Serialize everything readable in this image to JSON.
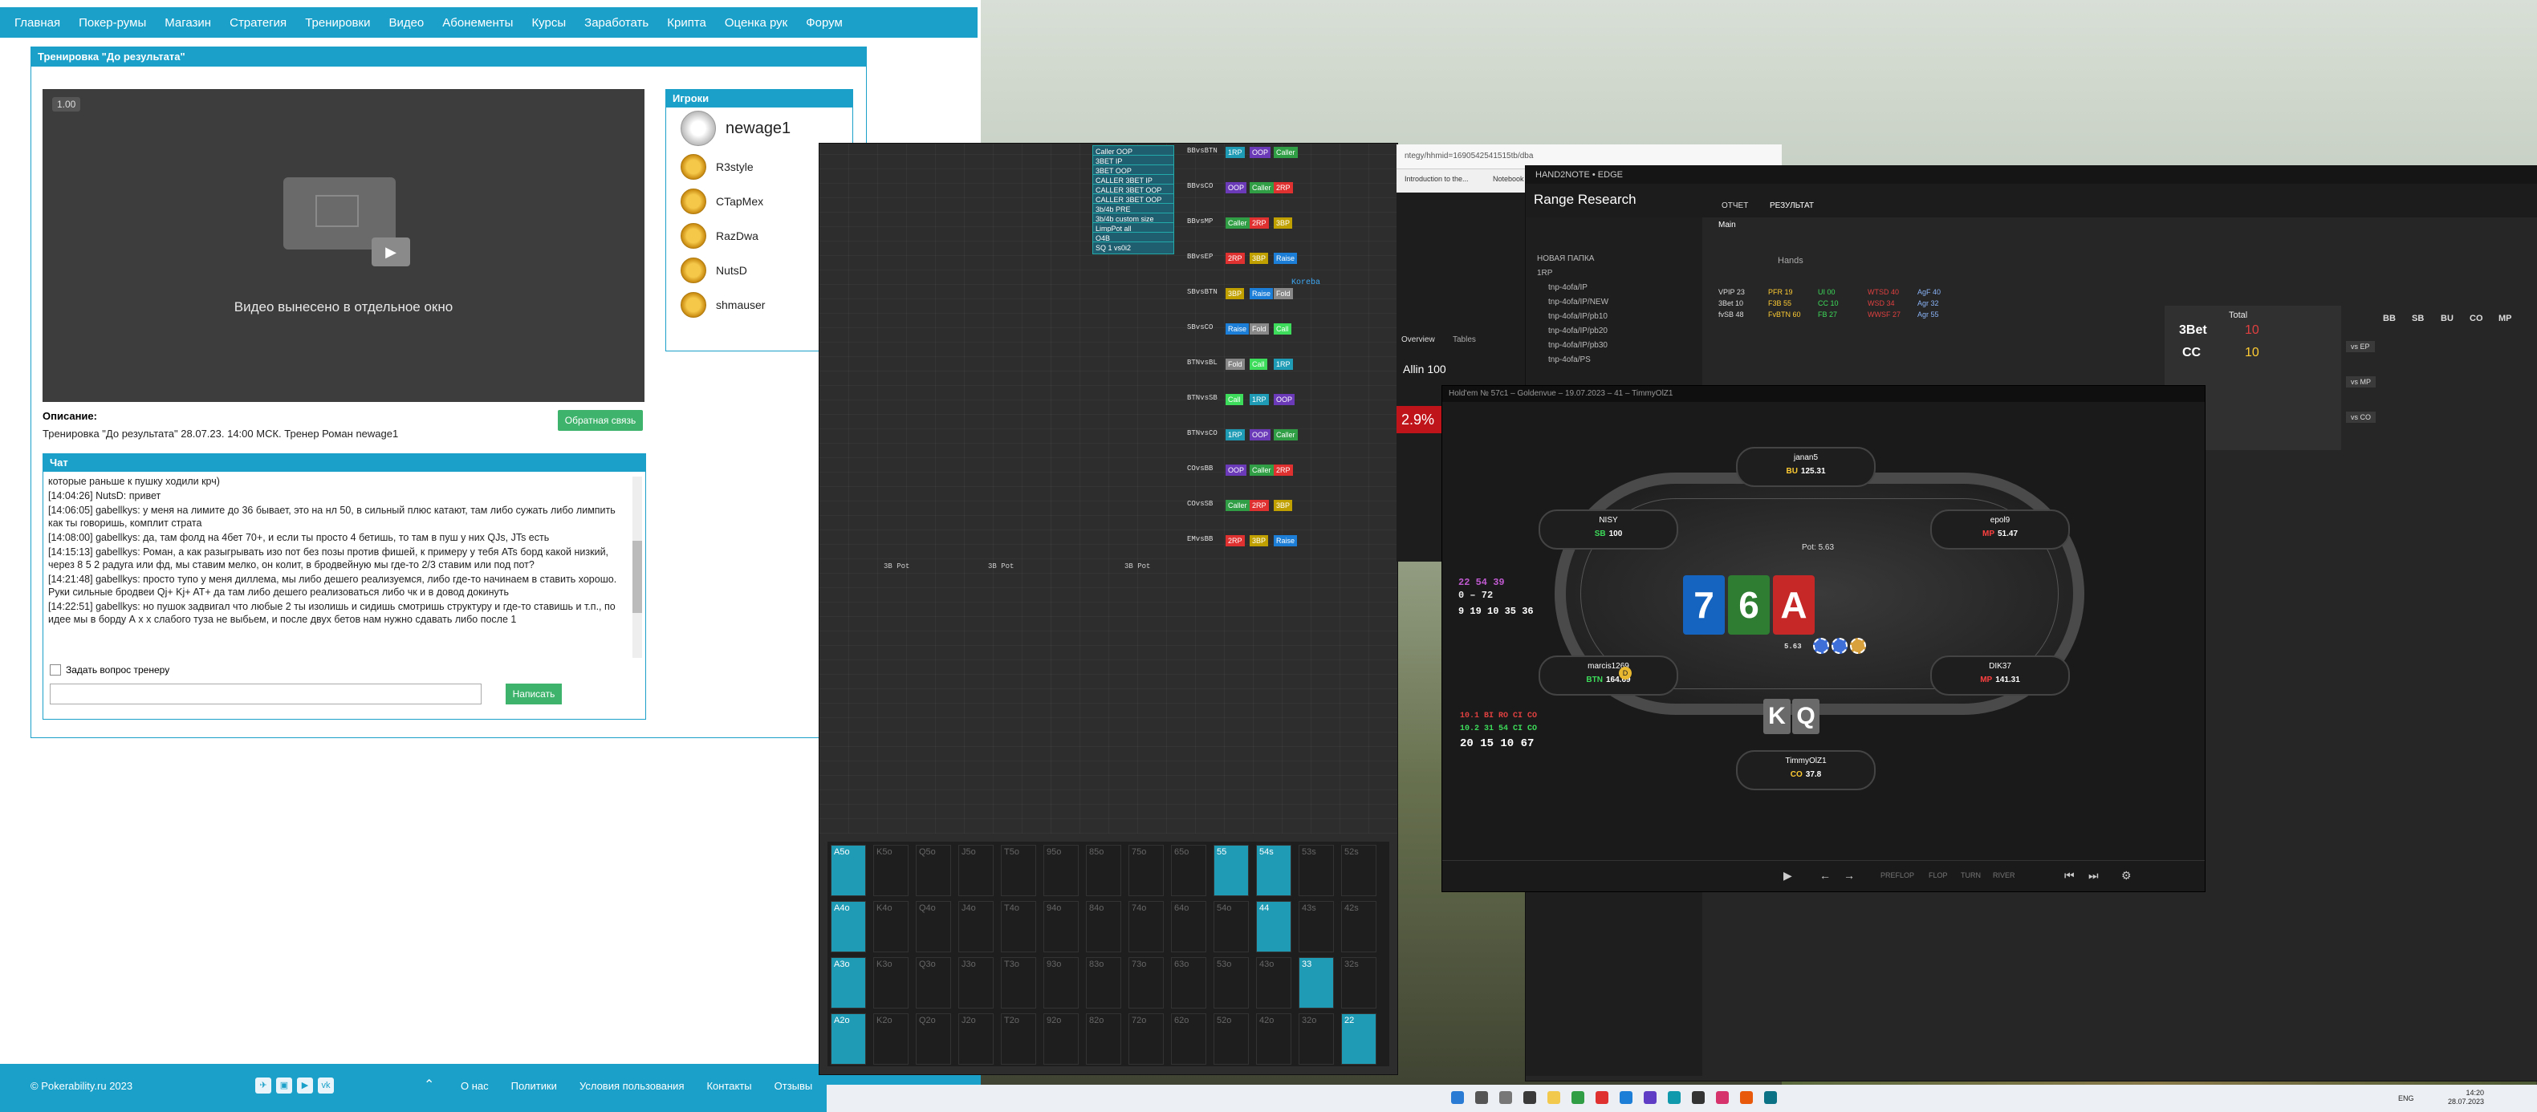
{
  "forum": {
    "nav": [
      "Главная",
      "Покер-румы",
      "Магазин",
      "Стратегия",
      "Тренировки",
      "Видео",
      "Абонементы",
      "Курсы",
      "Заработать",
      "Крипта",
      "Оценка рук",
      "Форум"
    ],
    "panel_title": "Тренировка \"До результата\"",
    "video": {
      "speed": "1.00",
      "message": "Видео вынесено в отдельное окно"
    },
    "players_title": "Игроки",
    "players": [
      "newage1",
      "R3style",
      "CTapMex",
      "RazDwa",
      "NutsD",
      "shmauser"
    ],
    "description_label": "Описание:",
    "description": "Тренировка \"До результата\" 28.07.23. 14:00 МСК. Тренер Роман newage1",
    "feedback_button": "Обратная связь",
    "chat_title": "Чат",
    "chat_messages": [
      "которые раньше к пушку ходили крч)",
      "[14:04:26] NutsD: привет",
      "[14:06:05] gabellkys: у меня на лимите до 36 бывает, это на нл 50, в сильный плюс катают, там либо сужать либо лимпить как ты говоришь, комплит страта",
      "[14:08:00] gabellkys: да, там фолд на 4бет 70+, и если ты просто 4 бетишь, то там в пуш у них QJs, JTs есть",
      "[14:15:13] gabellkys: Роман, а как разыгрывать изо пот без позы против фишей, к примеру у тебя ATs борд какой низкий, через 8 5 2 радуга или фд, мы ставим мелко, он колит, в бродвейную мы где-то 2/3 ставим или под пот?",
      "[14:21:48] gabellkys: просто тупо у меня диллема, мы либо дешего реализуемся, либо где-то начинаем в ставить хорошо. Руки сильные бродвеи Qj+ Kj+ AT+ да там либо дешего реализоваться либо чк и в довод докинуть",
      "[14:22:51] gabellkys: но пушок задвигал что любые 2 ты изолишь и сидишь смотришь структуру и где-то ставишь и т.п., по идее мы в борду А х х слабого туза не выбьем, и после двух бетов нам нужно сдавать либо после 1"
    ],
    "ask_trainer": "Задать вопрос тренеру",
    "send_button": "Написать",
    "footer": {
      "copyright": "© Pokerability.ru 2023",
      "links": [
        "О нас",
        "Политики",
        "Условия пользования",
        "Контакты",
        "Отзывы"
      ]
    }
  },
  "range_app": {
    "pills": [
      "Caller OOP",
      "3BET IP",
      "3BET OOP",
      "CALLER 3BET IP",
      "CALLER 3BET OOP",
      "CALLER 3BET OOP FP",
      "3b/4b PRE",
      "3b/4b custom size",
      "LimpPot all",
      "O4B",
      "SQ 1 vs0i2"
    ],
    "rows": [
      "BBvsBTN",
      "BBvsCO",
      "BBvsMP",
      "BBvsEP",
      "SBvsBTN",
      "SBvsCO",
      "BTNvsBL",
      "BTNvsSB",
      "BTNvsCO",
      "COvsBB",
      "COvsSB",
      "EMvsBB"
    ],
    "tags": [
      "1RP",
      "OOP",
      "Caller",
      "2RP",
      "3BP",
      "Raise",
      "Fold",
      "Call"
    ],
    "koreba": "Koreba",
    "pot_labels": [
      "3B Pot",
      "3B Pot",
      "3B Pot"
    ],
    "matrix": [
      [
        "A5o",
        "K5o",
        "Q5o",
        "J5o",
        "T5o",
        "95o",
        "85o",
        "75o",
        "65o",
        "55",
        "54s",
        "53s",
        "52s"
      ],
      [
        "A4o",
        "K4o",
        "Q4o",
        "J4o",
        "T4o",
        "94o",
        "84o",
        "74o",
        "64o",
        "54o",
        "44",
        "43s",
        "42s"
      ],
      [
        "A3o",
        "K3o",
        "Q3o",
        "J3o",
        "T3o",
        "93o",
        "83o",
        "73o",
        "63o",
        "53o",
        "43o",
        "33",
        "32s"
      ],
      [
        "A2o",
        "K2o",
        "Q2o",
        "J2o",
        "T2o",
        "92o",
        "82o",
        "72o",
        "62o",
        "52o",
        "42o",
        "32o",
        "22"
      ]
    ]
  },
  "browser": {
    "url": "ntegy/hhmid=1690542541515tb/dba",
    "tab1": "Introduction to the...",
    "tab2": "Notebook",
    "allin": "Allin 100",
    "pct": "2.9%",
    "overview": "Overview",
    "tables": "Tables"
  },
  "range_research": {
    "title": "HAND2NOTE • EDGE",
    "app_name": "Range Research",
    "tabs": [
      "ОТЧЕТ",
      "РЕЗУЛЬТАТ"
    ],
    "sub_tab": "Main",
    "tree": [
      "НОВАЯ ПАПКА",
      "1RP",
      "tnp-4ofa/IP",
      "tnp-4ofa/IP/NEW",
      "tnp-4ofa/IP/pb10",
      "tnp-4ofa/IP/pb20",
      "tnp-4ofa/IP/pb30",
      "tnp-4ofa/PS"
    ],
    "hands_label": "Hands",
    "total_label": "Total",
    "total_3bet": "3Bet",
    "total_3bet_val": "10",
    "total_cc": "CC",
    "total_cc_val": "10",
    "positions": [
      "BB",
      "SB",
      "BU",
      "CO",
      "MP"
    ],
    "vs": [
      "vs EP",
      "vs MP",
      "vs CO"
    ],
    "stats_left": [
      "VPIP 23",
      "PFR 19",
      "UI 00",
      "WTSD 40",
      "AgF 40",
      "3Bet 10",
      "F3B 55",
      "CC 10",
      "WSD 34",
      "Agr 32",
      "fvSB 48",
      "FvBTN 60",
      "FB 27",
      "WWSF 27",
      "Agr 55"
    ]
  },
  "poker": {
    "title": "Hold'em № 57c1 – Goldenvue – 19.07.2023 – 41 – TimmyOlZ1",
    "pot": "Pot: 5.63",
    "board": [
      "7",
      "6",
      "A"
    ],
    "board_colors": [
      "#1565c0",
      "#2e7d32",
      "#c62828"
    ],
    "hero_cards": [
      "K",
      "Q"
    ],
    "seats": [
      {
        "name": "janan5",
        "pos": "BU",
        "stack": "125.31",
        "pos_color": "yellow"
      },
      {
        "name": "NISY",
        "pos": "SB",
        "stack": "100",
        "pos_color": "green"
      },
      {
        "name": "epol9",
        "pos": "MP",
        "stack": "51.47",
        "pos_color": "red"
      },
      {
        "name": "marcis1269",
        "pos": "BTN",
        "stack": "164.69",
        "pos_color": "green"
      },
      {
        "name": "DIK37",
        "pos": "MP",
        "stack": "141.31",
        "pos_color": "red"
      },
      {
        "name": "TimmyOlZ1",
        "pos": "CO",
        "stack": "37.8",
        "pos_color": "yellow"
      }
    ],
    "hud_top": "22  54  39",
    "hud_mid": "0  –  72",
    "hud_bottom": "9  19  10  35  36",
    "hud2_head": "10.1  BI  RO  CI  CO",
    "hud2_row1": "10.2  31  54  CI  CO",
    "hud2_row2": "20  15  10  67",
    "pot_small": "5.63",
    "controls": [
      "PREFLOP",
      "FLOP",
      "TURN",
      "RIVER"
    ]
  },
  "taskbar": {
    "lang": "ENG",
    "time": "14:20",
    "date": "28.07.2023"
  }
}
